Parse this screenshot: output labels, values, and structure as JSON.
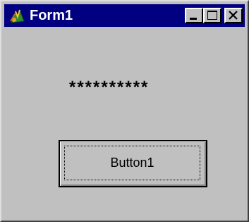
{
  "window": {
    "title": "Form1",
    "title_bar_color": "#000080",
    "background_color": "#c0c0c0",
    "icon": "delphi-app-icon",
    "controls": [
      "minimize-icon",
      "maximize-icon",
      "close-icon"
    ]
  },
  "form": {
    "password_mask": "**********",
    "button_label": "Button1"
  }
}
